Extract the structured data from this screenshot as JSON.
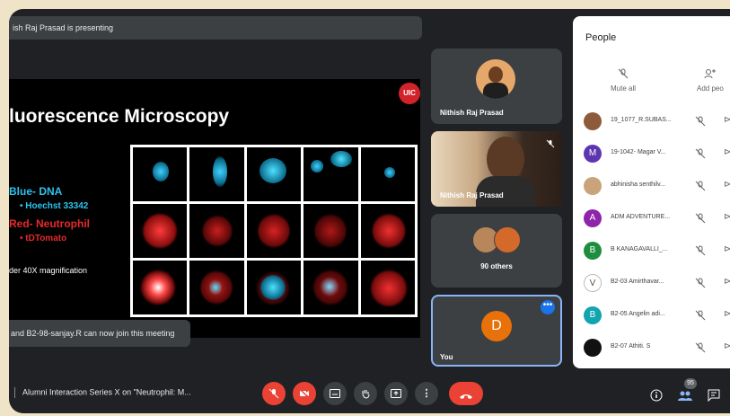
{
  "presenting_banner": "ish Raj Prasad is presenting",
  "slide": {
    "title": "luorescence Microscopy",
    "logo": "UIC",
    "legend": {
      "blue_title": "Blue- DNA",
      "blue_item": "• Hoechst 33342",
      "red_title": "Red- Neutrophil",
      "red_item": "• tDTomato",
      "magnification": "der 40X magnification"
    }
  },
  "notification": "and B2-98-sanjay.R can now join this meeting",
  "tiles": {
    "presenter_name": "Nithish Raj Prasad",
    "camera_name": "Nithish Raj Prasad",
    "others_label": "90 others",
    "you_initial": "D",
    "you_label": "You"
  },
  "people_panel": {
    "title": "People",
    "mute_all": "Mute all",
    "add_people": "Add peo",
    "participants": [
      {
        "initial": "",
        "name": "19_1077_R.SUBAS...",
        "color": "#8d5a3b"
      },
      {
        "initial": "M",
        "name": "19-1042- Magar V...",
        "color": "#5e35b1"
      },
      {
        "initial": "",
        "name": "abhinisha senthilv...",
        "color": "#c9a37a"
      },
      {
        "initial": "A",
        "name": "ADM ADVENTURE...",
        "color": "#8e24aa"
      },
      {
        "initial": "B",
        "name": "B KANAGAVALLI_...",
        "color": "#1e8e3e"
      },
      {
        "initial": "V",
        "name": "B2-03 Amirthavar...",
        "color": "#ffffff"
      },
      {
        "initial": "B",
        "name": "B2-05 Angelin adi...",
        "color": "#12a4af"
      },
      {
        "initial": "",
        "name": "B2-07 Athiti. S",
        "color": "#111111"
      }
    ]
  },
  "bottom_bar": {
    "meeting_title": "Alumni Interaction Series X on \"Neutrophil: M...",
    "people_count": "95"
  },
  "colors": {
    "frame": "#202124",
    "tile": "#3c4043",
    "danger": "#ea4335",
    "accent": "#1a73e8",
    "you_avatar": "#e8710a",
    "dna_blue": "#2bc4f0",
    "neutrophil_red": "#e8282c"
  }
}
